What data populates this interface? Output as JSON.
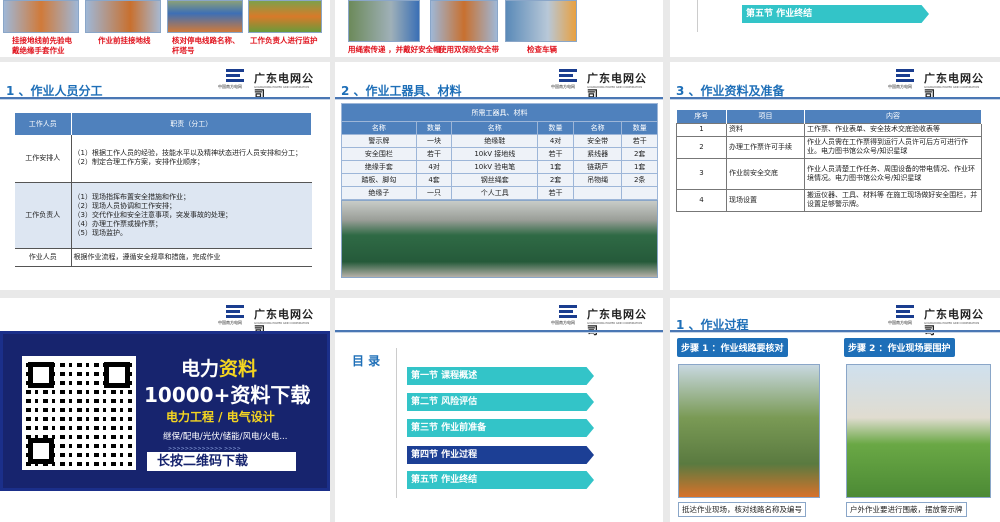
{
  "top_row": {
    "captions_left": [
      "挂接地线前先验电戴绝缘手套作业",
      "作业前挂接地线",
      "核对停电线路名称、杆塔号",
      "工作负责人进行监护"
    ],
    "captions_mid": [
      "用绳索传递 ，并戴好安全帽",
      "使用双保险安全带",
      "检查车辆"
    ],
    "right_section": "第五节  作业终结"
  },
  "logo": {
    "name": "广东电网公司",
    "cn_small": "中国南方电网",
    "en": "GUANGDONG POWER GRID CORPORATION"
  },
  "slide_staff": {
    "title": "1 、作业人员分工",
    "headers": [
      "工作人员",
      "职责（分工）"
    ],
    "rows": [
      {
        "role": "工作安排人",
        "duty": [
          "（1）根据工作人员的经验，技能水平以及精神状态进行人员安排和分工；",
          "（2）制定合理工作方案，安排作业顺序；"
        ]
      },
      {
        "role": "工作负责人",
        "duty": [
          "（1）现场指挥布置安全措施和作业；",
          "（2）现场人员协调和工作安排；",
          "（3）交代作业和安全注意事项，突发事故的处理；",
          "（4）办理工作票或操作票；",
          "（5）现场监护。"
        ]
      },
      {
        "role": "作业人员",
        "duty": [
          "根据作业流程，遵循安全规章和措施，完成作业"
        ]
      }
    ]
  },
  "slide_tools": {
    "title": "2 、作业工器具、材料",
    "table_title": "所需工器具、材料",
    "headers": [
      "名称",
      "数量",
      "名称",
      "数量",
      "名称",
      "数量"
    ],
    "rows": [
      [
        "警示牌",
        "一块",
        "绝缘鞋",
        "4对",
        "安全带",
        "若干"
      ],
      [
        "安全围栏",
        "若干",
        "10kV 接地线",
        "若干",
        "紧线器",
        "2套"
      ],
      [
        "绝缘手套",
        "4对",
        "10kV 验电笔",
        "1套",
        "链葫芦",
        "1套"
      ],
      [
        "踏板、脚勾",
        "4套",
        "钢丝绳套",
        "2套",
        "吊物绳",
        "2条"
      ],
      [
        "绝缘子",
        "一只",
        "个人工具",
        "若干",
        "",
        ""
      ]
    ]
  },
  "slide_docs": {
    "title": "3 、作业资料及准备",
    "headers": [
      "序号",
      "项目",
      "内容"
    ],
    "rows": [
      [
        "1",
        "资料",
        "工作票、作业表单、安全技术交底验收表等"
      ],
      [
        "2",
        "办理工作票许可手续",
        "作业人员需在工作票得到运行人员许可后方可进行作业。电力图书馆公众号/知识星球"
      ],
      [
        "3",
        "作业前安全交底",
        "作业人员清楚工作任务、周围设备的带电情况、作业环境情况。电力图书馆公众号/知识星球"
      ],
      [
        "4",
        "现场设置",
        "搬运仪器、工具、材料等 在施工现场做好安全围栏，并设置足够警示牌。"
      ]
    ]
  },
  "slide_ad": {
    "line1a": "电力",
    "line1b": "资料",
    "line2": "10000+资料下载",
    "line3": "电力工程 / 电气设计",
    "line4": "继保/配电/光伏/储能/风电/火电...",
    "arrows": ">>>>>>>>>>>>> >>>>",
    "button": "长按二维码下载"
  },
  "slide_toc": {
    "title": "目 录",
    "items": [
      "第一节    课程概述",
      "第二节  风险评估",
      "第三节  作业前准备",
      "第四节    作业过程",
      "第五节  作业终结"
    ],
    "active_index": 3,
    "colors": {
      "normal": "#33c4c8",
      "active": "#1c3f95"
    }
  },
  "slide_process": {
    "title": "1 、作业过程",
    "step1": "步骤 1 ：作业线路要核对",
    "step2": "步骤 2 ：作业现场要围护",
    "caption1": "抵达作业现场，核对线路名称及编号",
    "caption2": "户外作业要进行围蔽，摆放警示牌"
  }
}
